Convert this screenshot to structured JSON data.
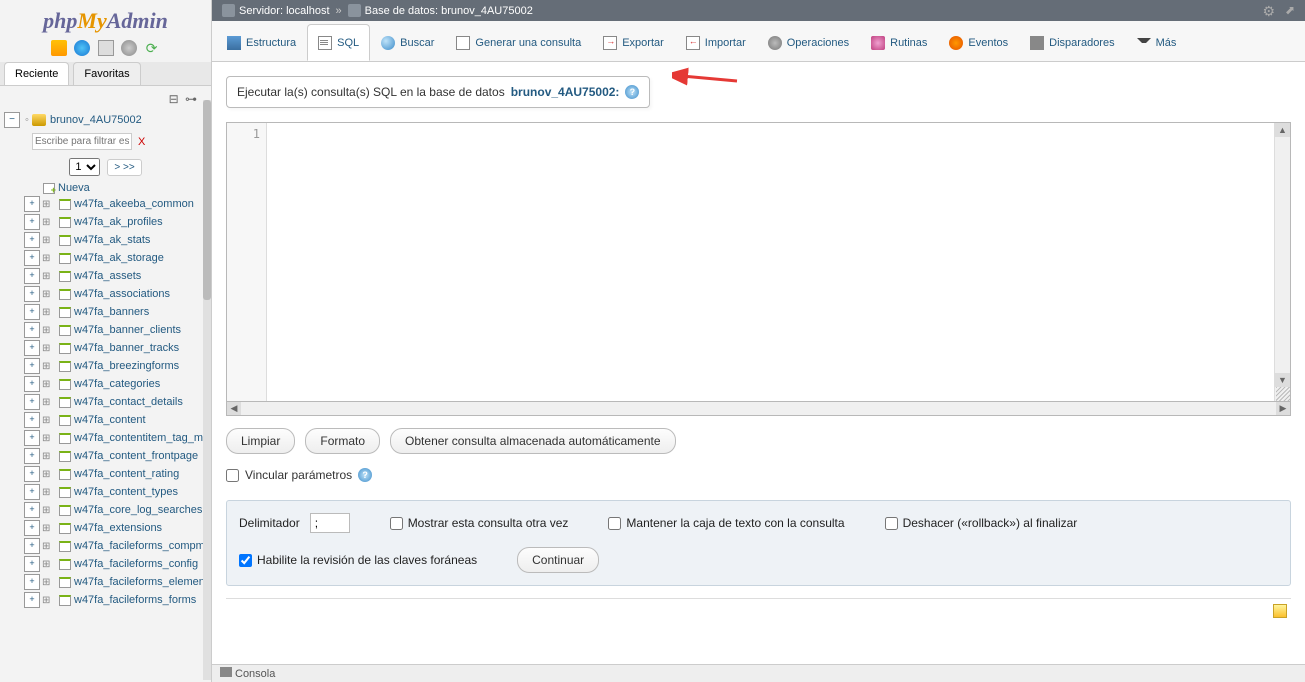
{
  "logo": {
    "php": "php",
    "my": "My",
    "admin": "Admin"
  },
  "side_tabs": {
    "recent": "Reciente",
    "favorites": "Favoritas"
  },
  "tree": {
    "db_name": "brunov_4AU75002",
    "filter_placeholder": "Escribe para filtrar estos,",
    "page_sel": "1",
    "nav_next": "> >>",
    "new_label": "Nueva",
    "tables": [
      "w47fa_akeeba_common",
      "w47fa_ak_profiles",
      "w47fa_ak_stats",
      "w47fa_ak_storage",
      "w47fa_assets",
      "w47fa_associations",
      "w47fa_banners",
      "w47fa_banner_clients",
      "w47fa_banner_tracks",
      "w47fa_breezingforms",
      "w47fa_categories",
      "w47fa_contact_details",
      "w47fa_content",
      "w47fa_contentitem_tag_m",
      "w47fa_content_frontpage",
      "w47fa_content_rating",
      "w47fa_content_types",
      "w47fa_core_log_searches",
      "w47fa_extensions",
      "w47fa_facileforms_compm",
      "w47fa_facileforms_config",
      "w47fa_facileforms_elemen",
      "w47fa_facileforms_forms"
    ]
  },
  "breadcrumb": {
    "server_label": "Servidor:",
    "server_name": "localhost",
    "db_label": "Base de datos:",
    "db_name": "brunov_4AU75002"
  },
  "tabs": {
    "structure": "Estructura",
    "sql": "SQL",
    "search": "Buscar",
    "generate": "Generar una consulta",
    "export": "Exportar",
    "import": "Importar",
    "operations": "Operaciones",
    "routines": "Rutinas",
    "events": "Eventos",
    "triggers": "Disparadores",
    "more": "Más"
  },
  "sql": {
    "heading_prefix": "Ejecutar la(s) consulta(s) SQL en la base de datos ",
    "heading_db": "brunov_4AU75002:",
    "gutter_1": "1",
    "buttons": {
      "clear": "Limpiar",
      "format": "Formato",
      "auto": "Obtener consulta almacenada automáticamente"
    },
    "bind_params": "Vincular parámetros",
    "delimiter_label": "Delimitador",
    "delimiter_value": ";",
    "show_again": "Mostrar esta consulta otra vez",
    "keep_box": "Mantener la caja de texto con la consulta",
    "rollback": "Deshacer («rollback») al finalizar",
    "fk_check": "Habilite la revisión de las claves foráneas",
    "continue": "Continuar"
  },
  "console": {
    "label": "Consola"
  }
}
